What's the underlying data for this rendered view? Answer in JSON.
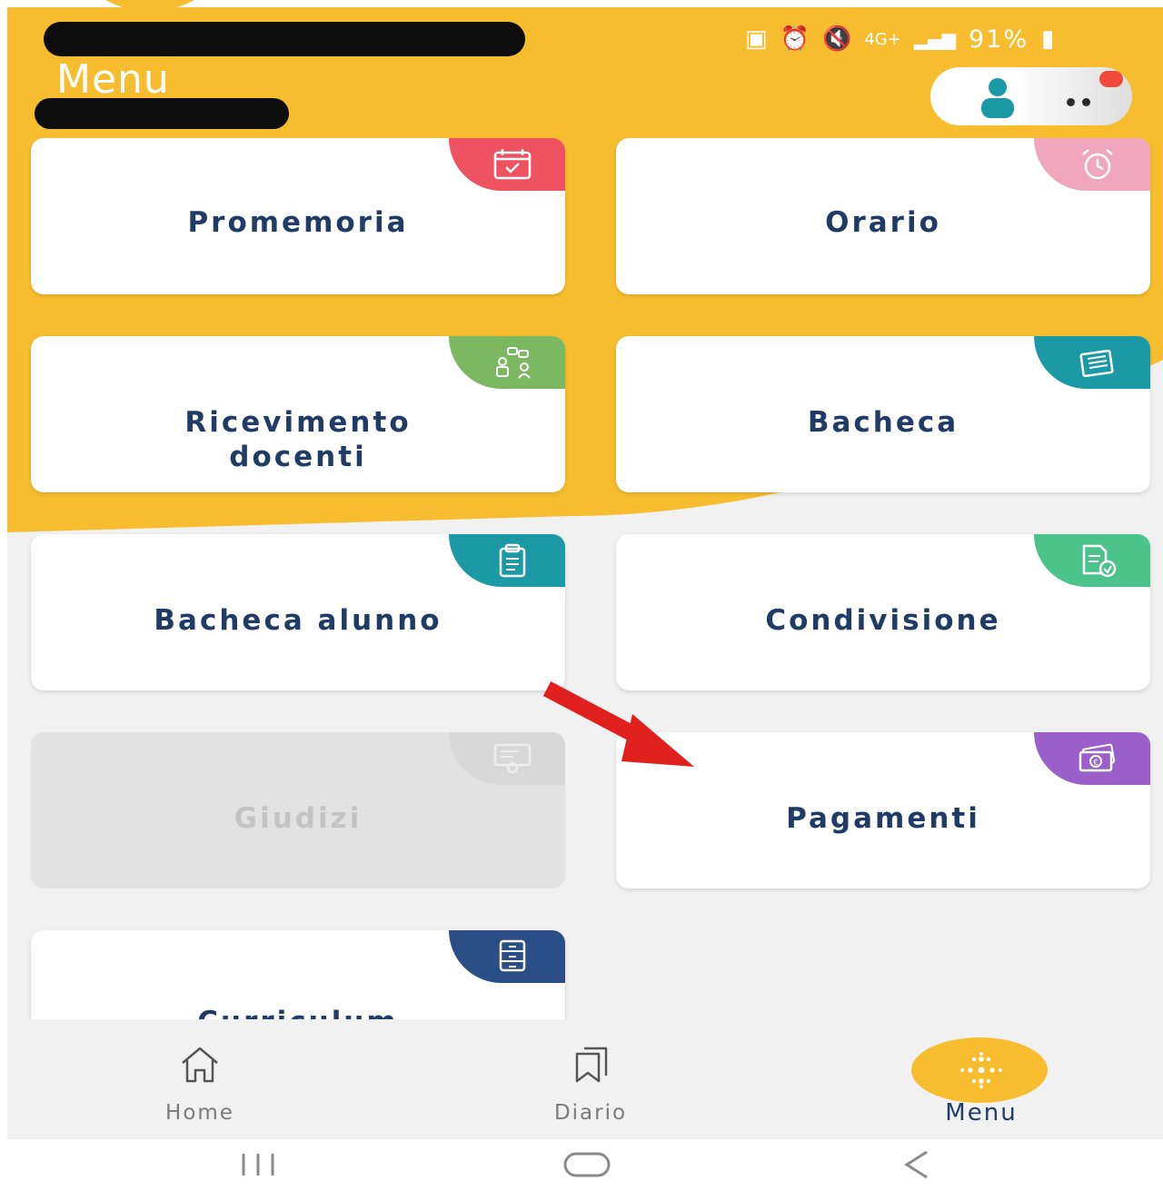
{
  "header": {
    "title": "Menu",
    "status_bar": {
      "battery": "91%"
    }
  },
  "cards": [
    {
      "label": "Promemoria",
      "icon": "calendar-check-icon",
      "badge_color": "#ee5160",
      "disabled": false
    },
    {
      "label": "Orario",
      "icon": "alarm-clock-icon",
      "badge_color": "#f0a7bd",
      "disabled": false
    },
    {
      "label": "Ricevimento docenti",
      "line1": "Ricevimento",
      "line2": "docenti",
      "icon": "meeting-icon",
      "badge_color": "#7cb862",
      "disabled": false
    },
    {
      "label": "Bacheca",
      "icon": "notice-board-icon",
      "badge_color": "#1b9aa6",
      "disabled": false
    },
    {
      "label": "Bacheca alunno",
      "icon": "clipboard-icon",
      "badge_color": "#1b9aa6",
      "disabled": false
    },
    {
      "label": "Condivisione",
      "icon": "document-share-icon",
      "badge_color": "#4cc38a",
      "disabled": false
    },
    {
      "label": "Giudizi",
      "icon": "certificate-icon",
      "badge_color": "#d8d8d8",
      "disabled": true
    },
    {
      "label": "Pagamenti",
      "icon": "money-icon",
      "badge_color": "#9a5fc9",
      "disabled": false
    },
    {
      "label": "Curriculum",
      "icon": "cabinet-icon",
      "badge_color": "#2b4e86",
      "disabled": false
    }
  ],
  "bottom_nav": {
    "items": [
      {
        "label": "Home",
        "icon": "home-icon"
      },
      {
        "label": "Diario",
        "icon": "bookmarks-icon"
      },
      {
        "label": "Menu",
        "icon": "dots-grid-icon",
        "active": true
      }
    ]
  },
  "colors": {
    "header_orange": "#f7bd2f",
    "text_navy": "#1f3b66",
    "background": "#f1f1f1",
    "arrow_red": "#e0201f"
  }
}
